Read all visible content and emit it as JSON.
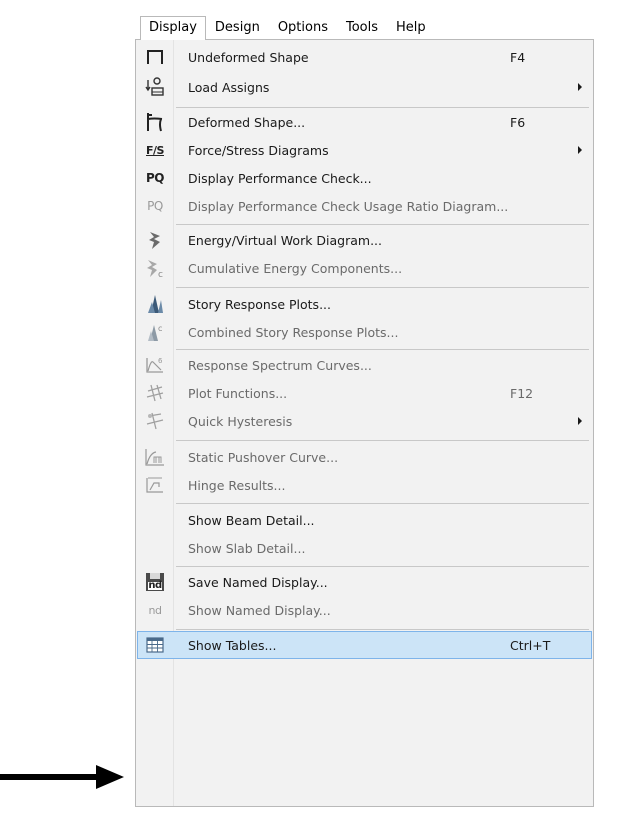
{
  "menubar": {
    "items": [
      {
        "label": "Display",
        "active": true
      },
      {
        "label": "Design"
      },
      {
        "label": "Options"
      },
      {
        "label": "Tools"
      },
      {
        "label": "Help"
      }
    ]
  },
  "menu": {
    "items": [
      {
        "label": "Undeformed Shape",
        "shortcut": "F4",
        "icon": "undeformed-shape-icon"
      },
      {
        "label": "Load Assigns",
        "submenu": true,
        "icon": "load-assigns-icon"
      },
      {
        "label": "Deformed Shape...",
        "shortcut": "F6",
        "icon": "deformed-shape-icon"
      },
      {
        "label": "Force/Stress Diagrams",
        "submenu": true,
        "icon": "force-stress-icon",
        "icon_text": "F/S"
      },
      {
        "label": "Display Performance Check...",
        "icon": "performance-check-icon",
        "icon_text": "PQ"
      },
      {
        "label": "Display Performance Check Usage Ratio Diagram...",
        "disabled": true,
        "icon": "usage-ratio-icon",
        "icon_text": "PQ"
      },
      {
        "label": "Energy/Virtual Work Diagram...",
        "icon": "energy-diagram-icon"
      },
      {
        "label": "Cumulative Energy Components...",
        "disabled": true,
        "icon": "cumulative-energy-icon"
      },
      {
        "label": "Story Response Plots...",
        "icon": "story-response-icon"
      },
      {
        "label": "Combined Story Response Plots...",
        "disabled": true,
        "icon": "combined-story-response-icon"
      },
      {
        "label": "Response Spectrum Curves...",
        "disabled": true,
        "icon": "response-spectrum-icon"
      },
      {
        "label": "Plot Functions...",
        "shortcut": "F12",
        "disabled": true,
        "icon": "plot-functions-icon"
      },
      {
        "label": "Quick Hysteresis",
        "submenu": true,
        "disabled": true,
        "icon": "quick-hysteresis-icon"
      },
      {
        "label": "Static Pushover Curve...",
        "disabled": true,
        "icon": "pushover-curve-icon"
      },
      {
        "label": "Hinge Results...",
        "disabled": true,
        "icon": "hinge-results-icon"
      },
      {
        "label": "Show Beam Detail..."
      },
      {
        "label": "Show Slab Detail...",
        "disabled": true
      },
      {
        "label": "Save Named Display...",
        "icon": "save-named-display-icon",
        "icon_text": "nd"
      },
      {
        "label": "Show Named Display...",
        "disabled": true,
        "icon": "show-named-display-icon",
        "icon_text": "nd"
      },
      {
        "label": "Show Tables...",
        "shortcut": "Ctrl+T",
        "hover": true,
        "icon": "table-icon"
      }
    ]
  },
  "colors": {
    "menu_bg": "#f2f2f2",
    "hover_bg": "#cce4f7",
    "hover_border": "#7eb4ea",
    "disabled_text": "#6a6a6a",
    "separator": "#c8c8c8"
  }
}
